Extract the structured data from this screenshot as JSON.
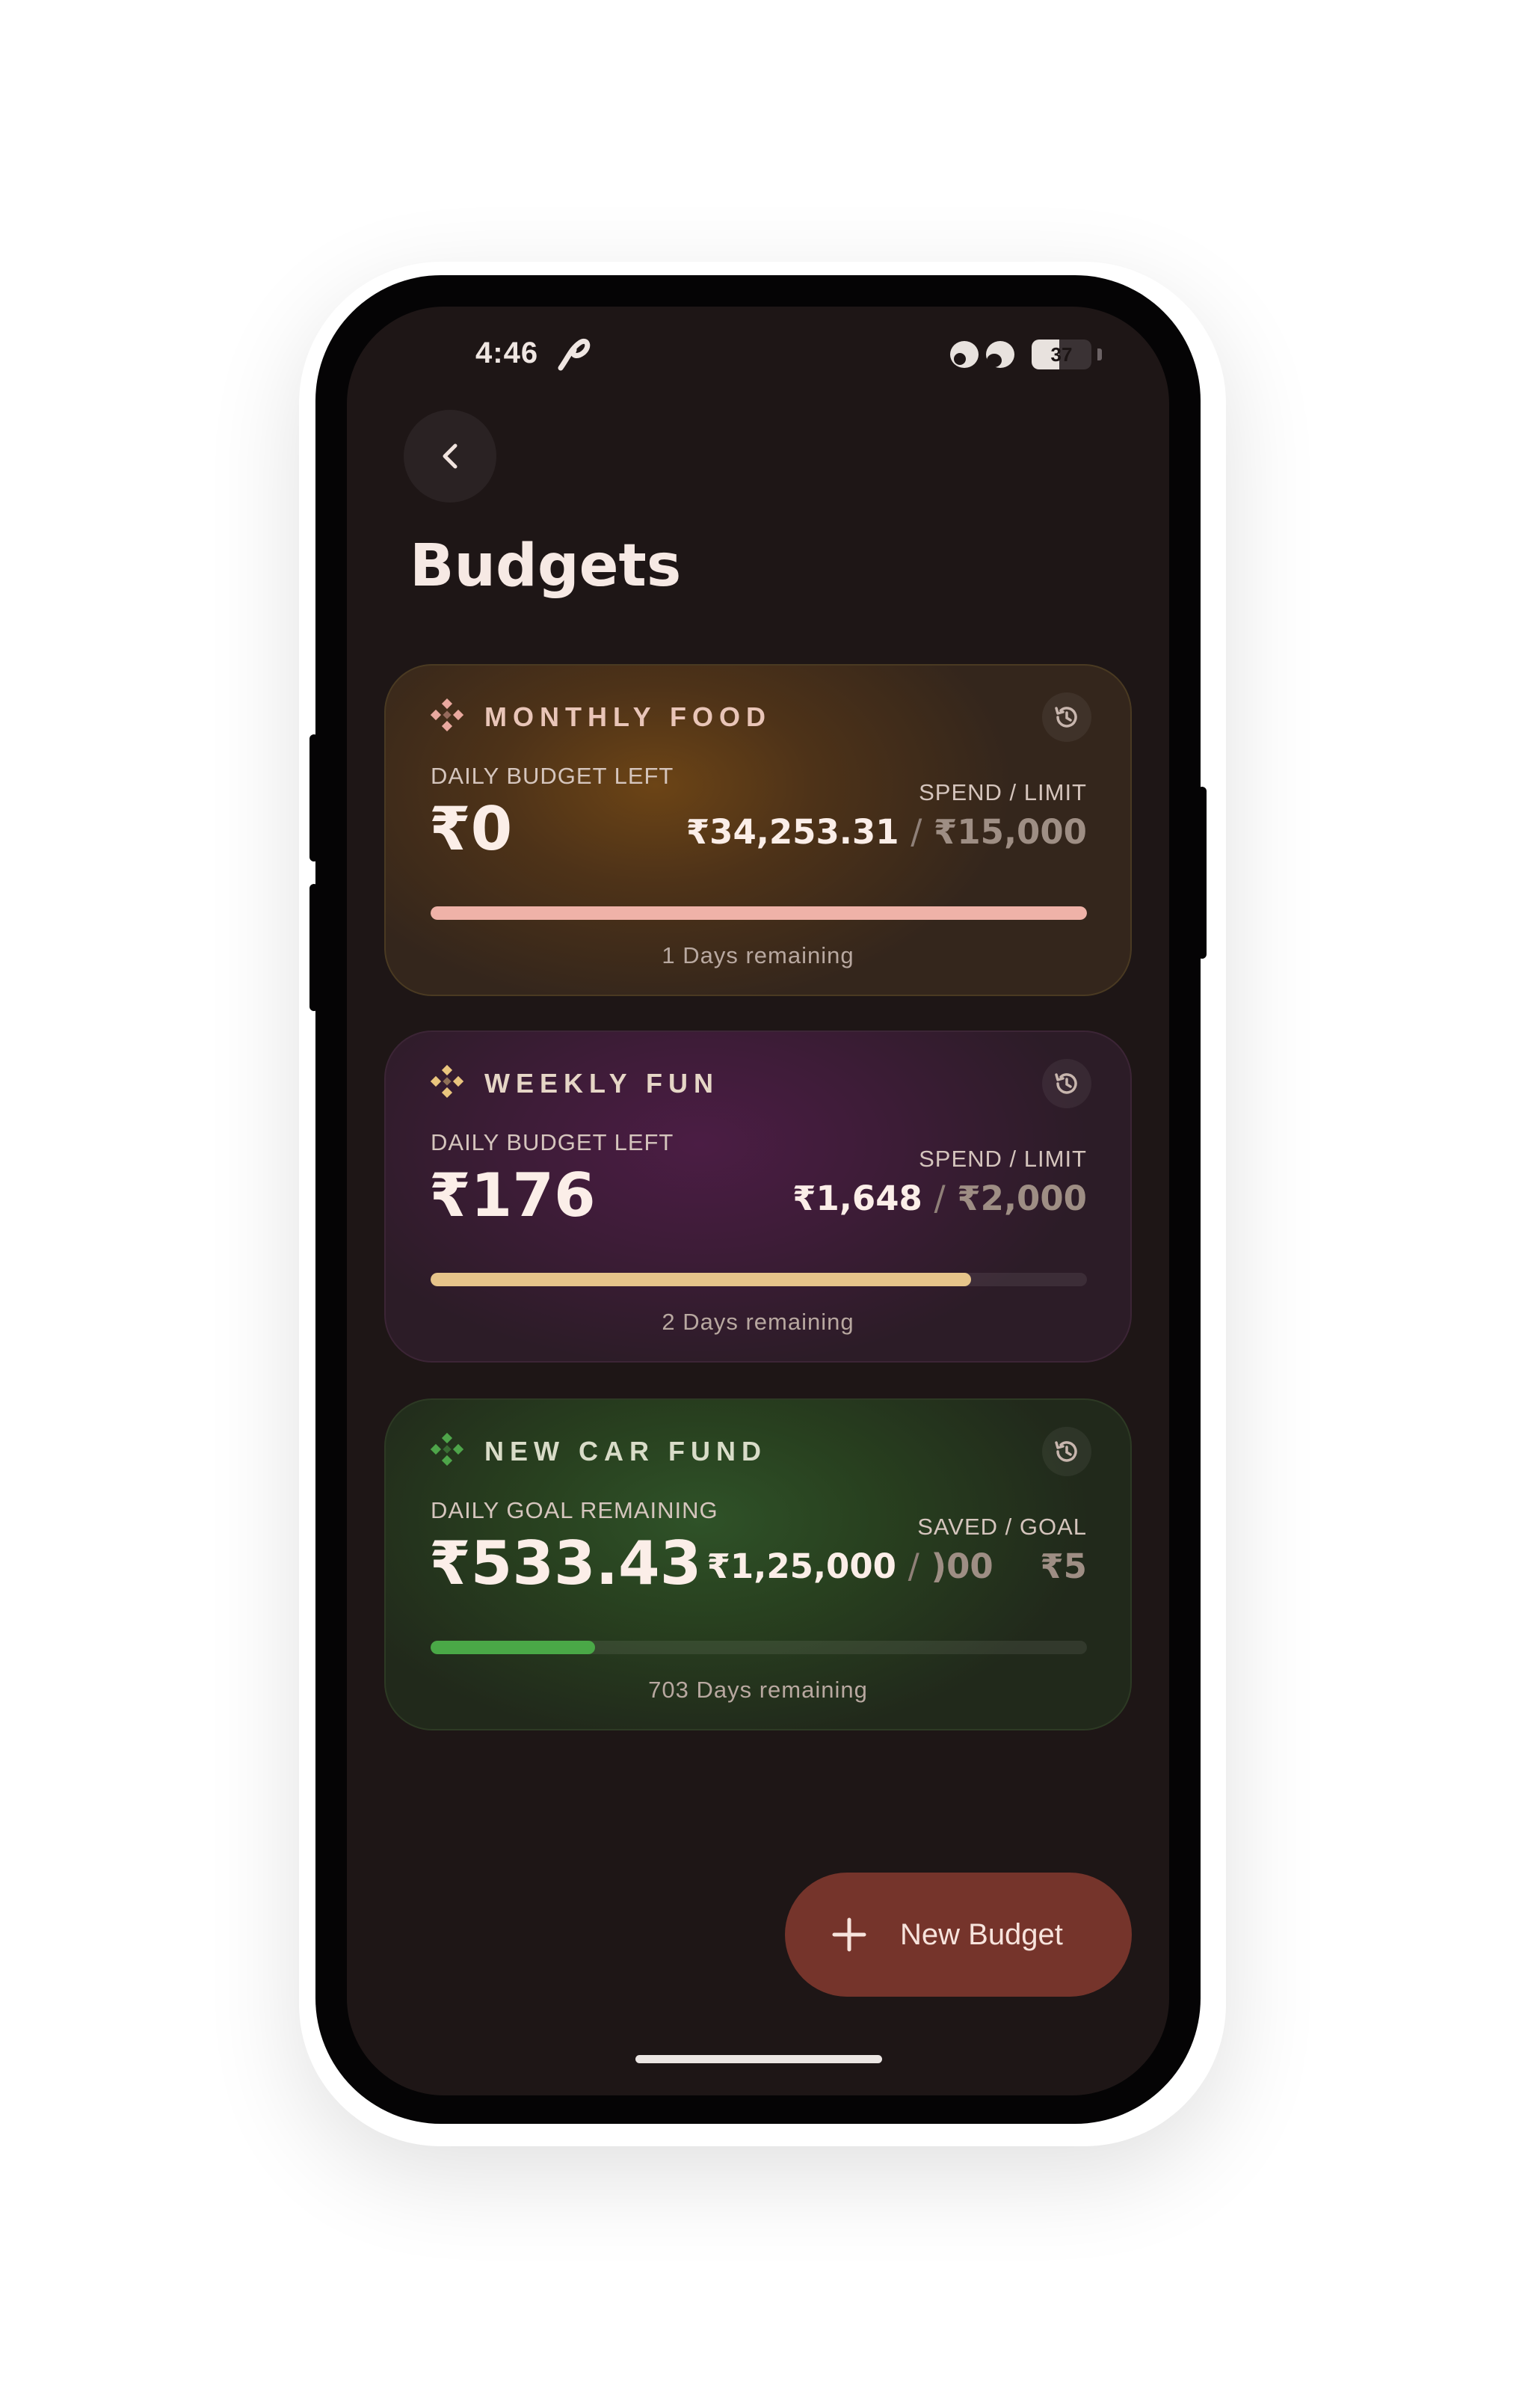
{
  "status_bar": {
    "time": "4:46",
    "battery": "37"
  },
  "page": {
    "title": "Budgets",
    "back_icon": "chevron-left-icon"
  },
  "budgets": [
    {
      "title": "MONTHLY FOOD",
      "accent": "#e9a89e",
      "left_label": "DAILY BUDGET LEFT",
      "left_value": "₹0",
      "right_label": "SPEND / LIMIT",
      "spent": "₹34,253.31",
      "separator": "/",
      "limit": "₹15,000",
      "progress": 1.0,
      "progress_color": "#efb2a8",
      "days_remaining": "1 Days remaining"
    },
    {
      "title": "WEEKLY FUN",
      "accent": "#e9c57e",
      "left_label": "DAILY BUDGET LEFT",
      "left_value": "₹176",
      "right_label": "SPEND / LIMIT",
      "spent": "₹1,648",
      "separator": "/",
      "limit": "₹2,000",
      "progress": 0.824,
      "progress_color": "#e6c48a",
      "days_remaining": "2 Days remaining"
    },
    {
      "title": "NEW CAR FUND",
      "accent": "#4ea54a",
      "left_label": "DAILY GOAL REMAINING",
      "left_value": "₹533.43",
      "right_label": "SAVED / GOAL",
      "spent": "₹1,25,000",
      "separator": "/",
      "limit": ")00    ₹5",
      "progress": 0.25,
      "progress_color": "#4aa847",
      "days_remaining": "703 Days remaining"
    }
  ],
  "fab": {
    "label": "New Budget",
    "icon": "plus-icon",
    "color": "#75342b"
  }
}
